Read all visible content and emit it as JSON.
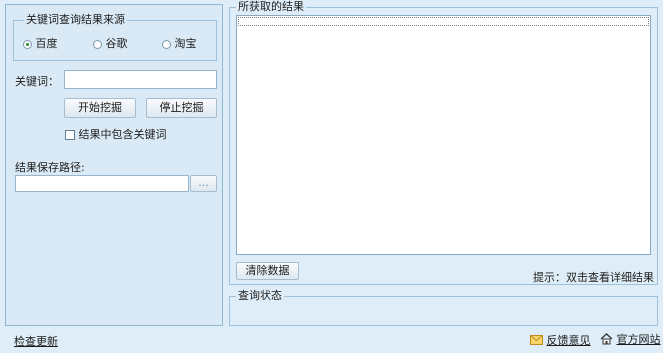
{
  "left_panel": {
    "source_group": {
      "title": "关键词查询结果来源",
      "options": [
        {
          "label": "百度",
          "selected": true
        },
        {
          "label": "谷歌",
          "selected": false
        },
        {
          "label": "淘宝",
          "selected": false
        }
      ]
    },
    "keyword_label": "关键词：",
    "keyword_value": "",
    "start_button": "开始挖掘",
    "stop_button": "停止挖掘",
    "include_keyword_label": "结果中包含关键词",
    "include_keyword_checked": false,
    "save_path_label": "结果保存路径:",
    "save_path_value": "",
    "browse_button": "..."
  },
  "results_group": {
    "title": "所获取的结果",
    "items": [],
    "clear_button": "清除数据",
    "hint": "提示：双击查看详细结果"
  },
  "status_group": {
    "title": "查询状态",
    "text": ""
  },
  "footer": {
    "check_update": "检查更新",
    "feedback": "反馈意见",
    "official_site": "官方网站"
  },
  "icons": {
    "feedback": "envelope-icon",
    "official_site": "home-icon"
  }
}
